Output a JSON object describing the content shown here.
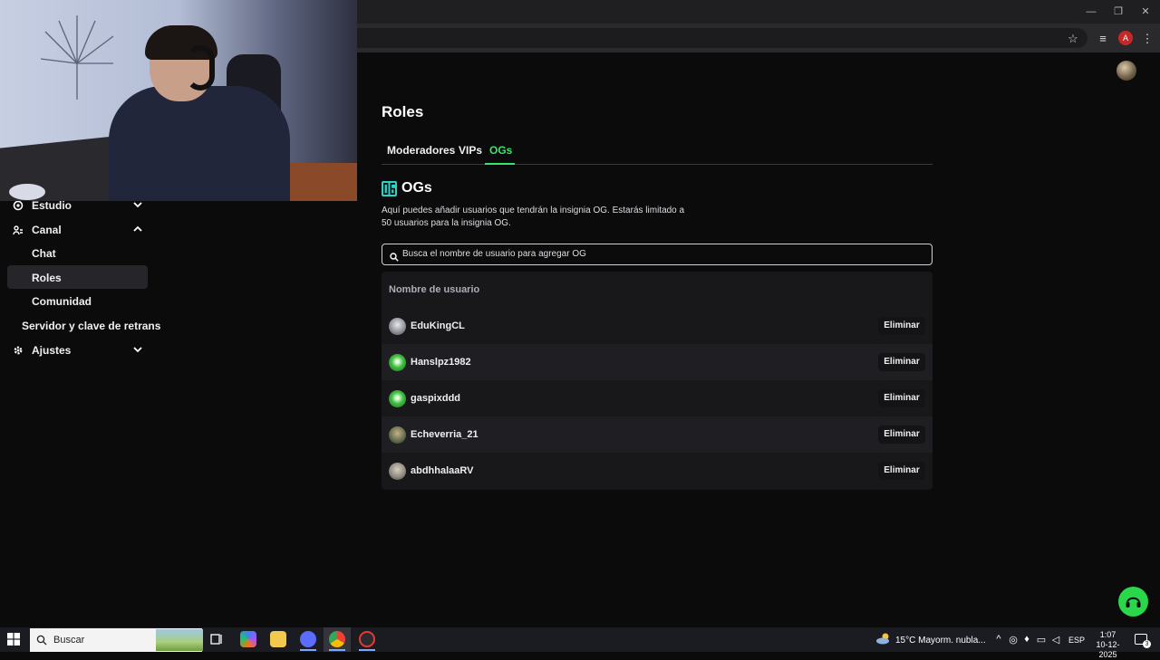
{
  "browser": {
    "window_controls": {
      "minimize": "—",
      "restore": "❐",
      "close": "✕"
    },
    "profile_initial": "A"
  },
  "sidebar": {
    "items": [
      {
        "label": "Estudio",
        "icon": "studio-icon",
        "chevron": "expand"
      },
      {
        "label": "Canal",
        "icon": "channel-icon",
        "chevron": "collapse"
      },
      {
        "label": "Chat",
        "sub": true
      },
      {
        "label": "Roles",
        "sub": true,
        "active": true
      },
      {
        "label": "Comunidad",
        "sub": true
      },
      {
        "label": "Servidor y clave de retrans",
        "sub": true,
        "indent": "half"
      },
      {
        "label": "Ajustes",
        "icon": "gear-icon",
        "chevron": "expand"
      }
    ]
  },
  "main": {
    "title": "Roles",
    "tabs": [
      {
        "label": "Moderadores",
        "active": false
      },
      {
        "label": "VIPs",
        "active": false
      },
      {
        "label": "OGs",
        "active": true
      }
    ],
    "section_heading": "OGs",
    "section_description": "Aquí puedes añadir usuarios que tendrán la insignia OG. Estarás limitado a 50 usuarios para la insignia OG.",
    "search_placeholder": "Busca el nombre de usuario para agregar OG",
    "table": {
      "column_header": "Nombre de usuario",
      "remove_label": "Eliminar",
      "rows": [
        {
          "username": "EduKingCL",
          "avatar_color": "#9a9aa3"
        },
        {
          "username": "Hanslpz1982",
          "avatar_color": "#3fbf3f"
        },
        {
          "username": "gaspixddd",
          "avatar_color": "#3fbf3f"
        },
        {
          "username": "Echeverria_21",
          "avatar_color": "#5c6b4a"
        },
        {
          "username": "abdhhalaaRV",
          "avatar_color": "#8b857a"
        }
      ]
    }
  },
  "colors": {
    "accent": "#39e36f",
    "background": "#0b0b0c",
    "table_bg": "#18181b",
    "help_fab": "#2bd74a"
  },
  "taskbar": {
    "search_label": "Buscar",
    "weather": "15°C  Mayorm. nubla...",
    "language": "ESP",
    "time": "1:07",
    "date": "10-12-2025",
    "notification_count": "3"
  }
}
